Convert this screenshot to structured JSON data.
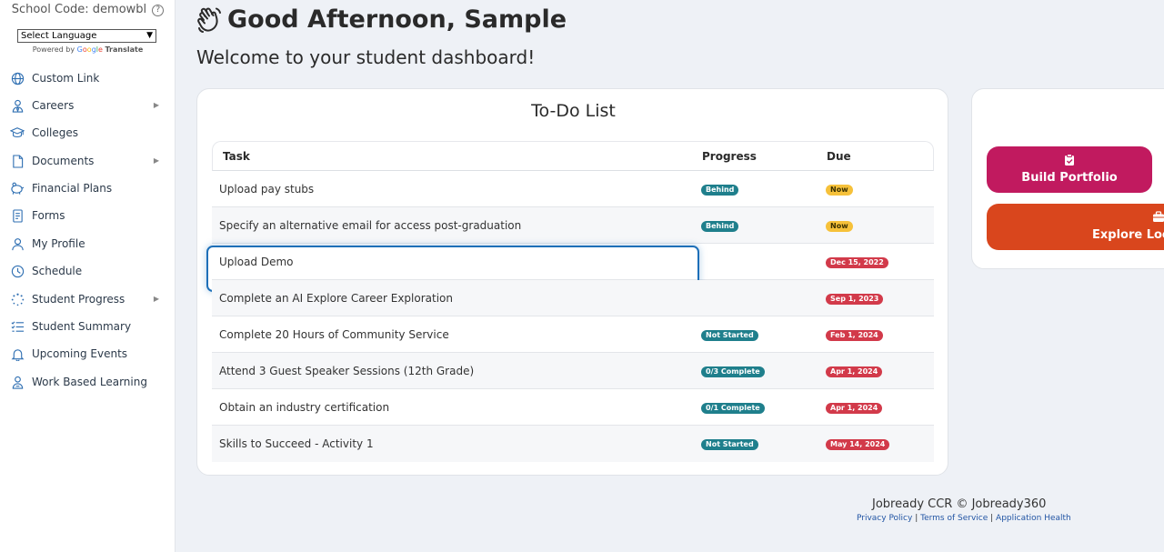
{
  "sidebar": {
    "school_code": "School Code: demowbl",
    "language_select": "Select Language",
    "powered_by": "Powered by",
    "google": [
      "G",
      "o",
      "o",
      "g",
      "l",
      "e"
    ],
    "translate": "Translate",
    "items": [
      {
        "label": "Custom Link",
        "icon": "globe-icon",
        "has_submenu": false
      },
      {
        "label": "Careers",
        "icon": "user-tie-icon",
        "has_submenu": true
      },
      {
        "label": "Colleges",
        "icon": "graduation-cap-icon",
        "has_submenu": false
      },
      {
        "label": "Documents",
        "icon": "document-icon",
        "has_submenu": true
      },
      {
        "label": "Financial Plans",
        "icon": "piggy-bank-icon",
        "has_submenu": false
      },
      {
        "label": "Forms",
        "icon": "form-icon",
        "has_submenu": false
      },
      {
        "label": "My Profile",
        "icon": "user-icon",
        "has_submenu": false
      },
      {
        "label": "Schedule",
        "icon": "clock-icon",
        "has_submenu": false
      },
      {
        "label": "Student Progress",
        "icon": "spinner-icon",
        "has_submenu": true
      },
      {
        "label": "Student Summary",
        "icon": "checklist-icon",
        "has_submenu": false
      },
      {
        "label": "Upcoming Events",
        "icon": "bell-icon",
        "has_submenu": false
      },
      {
        "label": "Work Based Learning",
        "icon": "user-badge-icon",
        "has_submenu": false
      }
    ]
  },
  "header": {
    "greeting": "Good Afternoon, Sample",
    "greeting_icon": "waving-hand-icon",
    "welcome": "Welcome to your student dashboard!"
  },
  "todo": {
    "title": "To-Do List",
    "columns": {
      "task": "Task",
      "progress": "Progress",
      "due": "Due"
    },
    "rows": [
      {
        "task": "Upload pay stubs",
        "progress": "Behind",
        "due": "Now",
        "due_style": "now"
      },
      {
        "task": "Specify an alternative email for access post-graduation",
        "progress": "Behind",
        "due": "Now",
        "due_style": "now"
      },
      {
        "task": "Upload Demo",
        "progress": "",
        "due": "Dec 15, 2022",
        "due_style": "late"
      },
      {
        "task": "Complete an AI Explore Career Exploration",
        "progress": "",
        "due": "Sep 1, 2023",
        "due_style": "late"
      },
      {
        "task": "Complete 20 Hours of Community Service",
        "progress": "Not Started",
        "due": "Feb 1, 2024",
        "due_style": "late"
      },
      {
        "task": "Attend 3 Guest Speaker Sessions (12th Grade)",
        "progress": "0/3 Complete",
        "due": "Apr 1, 2024",
        "due_style": "late"
      },
      {
        "task": "Obtain an industry certification",
        "progress": "0/1 Complete",
        "due": "Apr 1, 2024",
        "due_style": "late"
      },
      {
        "task": "Skills to Succeed - Activity 1",
        "progress": "Not Started",
        "due": "May 14, 2024",
        "due_style": "late"
      }
    ]
  },
  "actions": {
    "build_portfolio": "Build Portfolio",
    "build_portfolio_icon": "clipboard-check-icon",
    "explore_local": "Explore Loca",
    "explore_local_icon": "briefcase-icon"
  },
  "footer": {
    "copyright": "Jobready CCR © Jobready360",
    "links": [
      "Privacy Policy",
      "Terms of Service",
      "Application Health"
    ],
    "separator": " | "
  },
  "colors": {
    "portfolio": "#c11a5f",
    "explore": "#d9461d",
    "progress_badge": "#1f7f8c",
    "due_now": "#f6c13a",
    "due_late": "#d23a4a",
    "focus_outline": "#1d6fb8"
  }
}
